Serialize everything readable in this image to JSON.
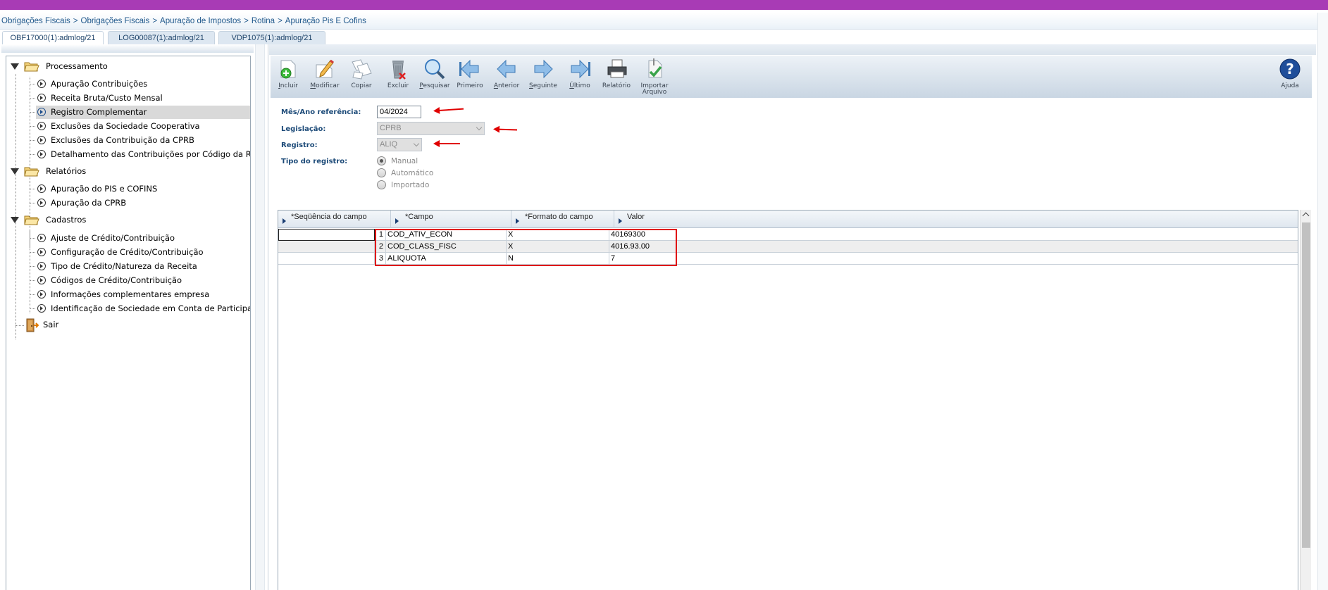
{
  "breadcrumb": [
    "Obrigações Fiscais",
    "Obrigações Fiscais",
    "Apuração de Impostos",
    "Rotina",
    "Apuração Pis E Cofins"
  ],
  "breadcrumb_separator": ">",
  "tabs": [
    {
      "label": "OBF17000(1):admlog/21",
      "active": true
    },
    {
      "label": "LOG00087(1):admlog/21",
      "active": false
    },
    {
      "label": "VDP1075(1):admlog/21",
      "active": false
    }
  ],
  "tree": {
    "groups": [
      {
        "label": "Processamento",
        "items": [
          {
            "label": "Apuração Contribuições",
            "selected": false
          },
          {
            "label": "Receita Bruta/Custo Mensal",
            "selected": false
          },
          {
            "label": "Registro Complementar",
            "selected": true
          },
          {
            "label": "Exclusões da Sociedade Cooperativa",
            "selected": false
          },
          {
            "label": "Exclusões da Contribuição da CPRB",
            "selected": false
          },
          {
            "label": "Detalhamento das Contribuições por Código da Recei",
            "selected": false
          }
        ]
      },
      {
        "label": "Relatórios",
        "items": [
          {
            "label": "Apuração do PIS e COFINS",
            "selected": false
          },
          {
            "label": "Apuração da CPRB",
            "selected": false
          }
        ]
      },
      {
        "label": "Cadastros",
        "items": [
          {
            "label": "Ajuste de Crédito/Contribuição",
            "selected": false
          },
          {
            "label": "Configuração de Crédito/Contribuição",
            "selected": false
          },
          {
            "label": "Tipo de Crédito/Natureza da Receita",
            "selected": false
          },
          {
            "label": "Códigos de Crédito/Contribuição",
            "selected": false
          },
          {
            "label": "Informações complementares empresa",
            "selected": false
          },
          {
            "label": "Identificação de Sociedade em Conta de Participação",
            "selected": false
          }
        ]
      }
    ],
    "exit_label": "Sair"
  },
  "toolbar": {
    "buttons": [
      {
        "label": "Incluir",
        "icon": "add-icon"
      },
      {
        "label": "Modificar",
        "icon": "edit-icon"
      },
      {
        "label": "Copiar",
        "icon": "copy-icon"
      },
      {
        "label": "Excluir",
        "icon": "delete-icon"
      },
      {
        "label": "Pesquisar",
        "icon": "search-icon"
      },
      {
        "label": "Primeiro",
        "icon": "first-icon"
      },
      {
        "label": "Anterior",
        "icon": "previous-icon"
      },
      {
        "label": "Seguinte",
        "icon": "next-icon"
      },
      {
        "label": "Último",
        "icon": "last-icon"
      },
      {
        "label": "Relatório",
        "icon": "print-icon"
      },
      {
        "label": "Importar Arquivo",
        "icon": "import-icon"
      }
    ],
    "help_label": "Ajuda"
  },
  "form": {
    "period_label": "Mês/Ano referência:",
    "period_value": "04/2024",
    "legislation_label": "Legislação:",
    "legislation_value": "CPRB",
    "register_label": "Registro:",
    "register_value": "ALIQ",
    "type_label": "Tipo do registro:",
    "type_options": [
      {
        "label": "Manual",
        "checked": true
      },
      {
        "label": "Automático",
        "checked": false
      },
      {
        "label": "Importado",
        "checked": false
      }
    ]
  },
  "grid": {
    "columns": [
      "*Seqüência do campo",
      "*Campo",
      "*Formato do campo",
      "Valor"
    ],
    "rows": [
      {
        "seq": "1",
        "campo": "COD_ATIV_ECON",
        "formato": "X",
        "valor": "40169300"
      },
      {
        "seq": "2",
        "campo": "COD_CLASS_FISC",
        "formato": "X",
        "valor": "4016.93.00"
      },
      {
        "seq": "3",
        "campo": "ALIQUOTA",
        "formato": "N",
        "valor": "7"
      }
    ]
  },
  "colors": {
    "top_bar": "#a83bb5",
    "breadcrumb_text": "#21598c",
    "label_blue": "#1c4a78",
    "annotation_red": "#e00000"
  }
}
